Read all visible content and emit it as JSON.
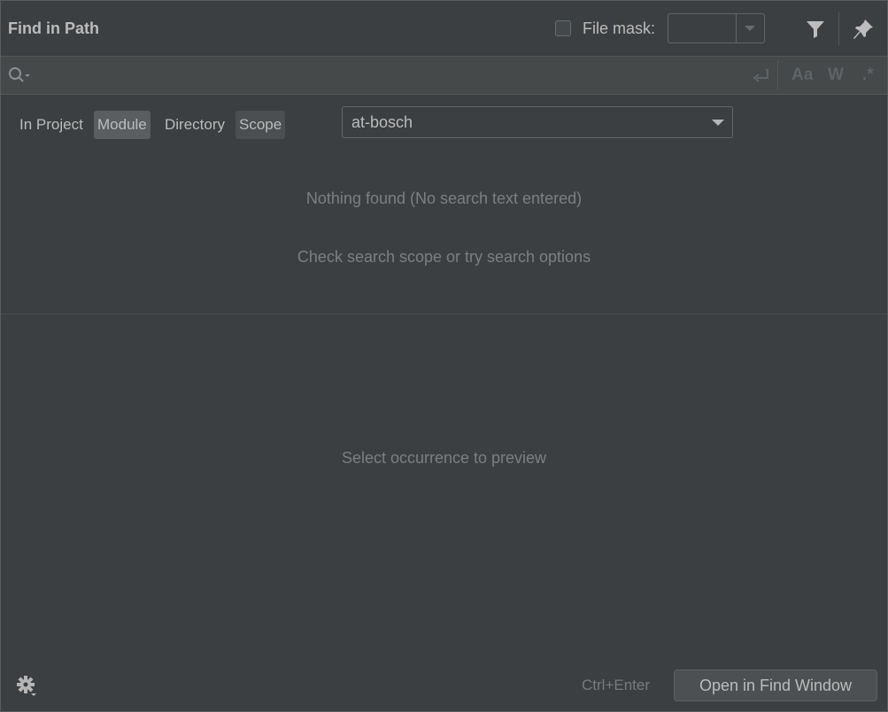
{
  "window": {
    "title": "Find in Path"
  },
  "header": {
    "file_mask_label": "File mask:",
    "file_mask_checked": false,
    "file_mask_value": ""
  },
  "search": {
    "value": "",
    "placeholder": ""
  },
  "search_options": {
    "match_case": "Aa",
    "words": "W",
    "regex": ".*"
  },
  "scope_tabs": [
    {
      "label": "In Project",
      "selected": false
    },
    {
      "label": "Module",
      "selected": true
    },
    {
      "label": "Directory",
      "selected": false
    },
    {
      "label": "Scope",
      "selected": false
    }
  ],
  "module_select": {
    "value": "at-bosch"
  },
  "results": {
    "empty_message": "Nothing found (No search text entered)",
    "hint_message": "Check search scope or try search options"
  },
  "preview": {
    "message": "Select occurrence to preview"
  },
  "footer": {
    "shortcut": "Ctrl+Enter",
    "open_button": "Open in Find Window"
  },
  "colors": {
    "background": "#3c3f41",
    "search_bar": "#45494a",
    "text": "#bbbbbb",
    "muted_text": "#7c7f81",
    "selected_tab": "#5a5e61"
  }
}
